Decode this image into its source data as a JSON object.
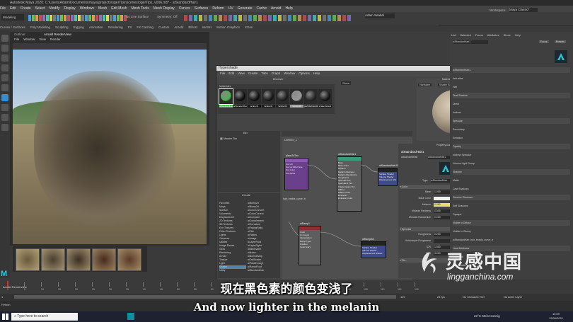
{
  "window": {
    "title": "Autodesk Maya 2020: C:\\Users\\Adam\\Documents\\maya\\projects\\ogerTips\\scenes\\ogerTips_v006.mb* - aiStandardHair1",
    "workspace_label": "Workspace:",
    "workspace_value": "Maya Classic*"
  },
  "menubar": {
    "mode": "Modeling",
    "items": [
      "File",
      "Edit",
      "Create",
      "Select",
      "Modify",
      "Display",
      "Windows",
      "Mesh",
      "Edit Mesh",
      "Mesh Tools",
      "Mesh Display",
      "Curves",
      "Surfaces",
      "Deform",
      "UV",
      "Generate",
      "Cache",
      "Arnold",
      "Help"
    ]
  },
  "shelf": {
    "tabs": [
      "Curves / Surfaces",
      "Poly Modeling",
      "Sculpting",
      "Rigging",
      "Animation",
      "Rendering",
      "FX",
      "FX Caching",
      "Custom",
      "Arnold",
      "Bifrost",
      "MASH",
      "Motion Graphics",
      "XGen"
    ],
    "live_surface": "No Live Surface",
    "symmetry": "Symmetry: Off",
    "sign_in": "Adam Seakal"
  },
  "render_view": {
    "panel_tabs": [
      "Outliner",
      "Arnold RenderView"
    ],
    "menu": [
      "File",
      "Window",
      "View",
      "Render"
    ]
  },
  "hypershade": {
    "title": "Hypershade",
    "menu": [
      "File",
      "Edit",
      "View",
      "Create",
      "Tabs",
      "Graph",
      "Window",
      "Options",
      "Help"
    ],
    "browser_label": "Browser",
    "materials_tab": "Materials",
    "show_label": "Show",
    "materials": [
      {
        "name": "aiStandardHair1",
        "color": "#4caf50",
        "selected": true
      },
      {
        "name": "aiStandardSurf",
        "color": "#111111",
        "selected": false
      },
      {
        "name": "lambert1",
        "color": "#141414",
        "selected": false
      },
      {
        "name": "lambert2",
        "color": "#1b1b1b",
        "selected": false
      },
      {
        "name": "lambert3",
        "color": "#222222",
        "selected": false
      },
      {
        "name": "lambert4",
        "color": "#9a9a9a",
        "selected": false
      },
      {
        "name": "particleCloud1",
        "color": "#2a2a2a",
        "selected": false
      },
      {
        "name": "shaderGlow1",
        "color": "#181818",
        "selected": false
      }
    ],
    "bin_label": "Bin",
    "master_bin": "Master Bin",
    "create_label": "Create",
    "create_tree": [
      "Favorites",
      "Maya",
      "Surface",
      "Volumetric",
      "Displacement",
      "2D Textures",
      "3D Textures",
      "Env Textures",
      "Other Textures",
      "Lights",
      "Cameras",
      "Utilities",
      "Image Planes",
      "Glow",
      "Rendering",
      "Arnold",
      "Texture",
      "Light",
      "Shader",
      "Utility"
    ],
    "create_list": [
      "aiBump2d",
      "aiBump3d",
      "aiColorConvert",
      "aiColorCorrect",
      "aiCompare",
      "aiComplement",
      "aiCurvature",
      "aiFacingRatio",
      "aiFlat",
      "aiFlakes",
      "aiImage",
      "aiLayerFloat",
      "aiLayerRgba",
      "aiMixShader",
      "aiNoise",
      "aiNormalMap",
      "aiOslShader",
      "aiPassthrough",
      "aiRampFloat",
      "aiStandardHair"
    ],
    "graph_tab": "Untitled_1",
    "nodes": {
      "place": {
        "title": "place2dTex",
        "ports": [
          "Out UV",
          "Out Uv Filter Size",
          "Out Color",
          "Out Alpha"
        ]
      },
      "hair": {
        "title": "aiStandardHair1",
        "ports": [
          "Base",
          "Base Color",
          "Melanin",
          "Melanin Redness",
          "Melanin Randomize",
          "Roughness",
          "Specular Tint",
          "Specular 2 Tint",
          "Transmission Tint",
          "Diffuse",
          "Diffuse Color",
          "Emission",
          "Emission Color"
        ]
      },
      "sg1": {
        "title": "aiStandardHair1SG",
        "ports": [
          "Surface Shader",
          "Volume Shader",
          "Displacement Shader"
        ]
      },
      "ramp": {
        "title": "aiRamp1",
        "ports": [
          "Color",
          "Uv Coord",
          "Interpolation",
          "Ramp Type",
          "Position",
          "Color Entry"
        ]
      },
      "sg2": {
        "title": "aiRampSG",
        "ports": [
          "Surface Shader",
          "Volume Shader",
          "Displacement Shader"
        ]
      },
      "hair_label": "hair_braids_curve_tr"
    },
    "material_viewer": {
      "label": "Material Viewer",
      "renderer": "Hardware",
      "geometry": "Shader Ball",
      "env": "Interior Cube"
    },
    "property_editor": {
      "label": "Property Editor",
      "node_name": "aiStandardHair1",
      "type_label": "aiStandardHair",
      "presets": "Presets",
      "type_row_label": "Type",
      "type_row_value": "aiStandardHair",
      "sections": [
        "Color",
        "Specular",
        "Tint"
      ],
      "rows": [
        {
          "label": "Base",
          "value": "1.000",
          "fill": 1.0
        },
        {
          "label": "Base Color",
          "value": "",
          "fill": 1.0
        },
        {
          "label": "Melanin",
          "value": "0.060",
          "fill": 0.06
        },
        {
          "label": "Melanin Redness",
          "value": "0.500",
          "fill": 0.5
        },
        {
          "label": "Melanin Randomize",
          "value": "0.000",
          "fill": 0.0
        },
        {
          "label": "Roughness",
          "value": "0.200",
          "fill": 0.2
        },
        {
          "label": "Anisotropic Roughness",
          "value": "",
          "fill": 0.0
        },
        {
          "label": "IOR",
          "value": "1.550",
          "fill": 0.55
        },
        {
          "label": "Shift",
          "value": "3.000",
          "fill": 0.15
        }
      ]
    }
  },
  "attribute_editor": {
    "tabs": [
      "List",
      "Selected",
      "Focus",
      "Attributes",
      "Show",
      "Help"
    ],
    "node_field": "aiStandardHair1",
    "focus": "Focus",
    "presets": "Presets",
    "show": "Show",
    "hide": "Hide",
    "items": [
      "aiStandardHair1",
      "Anti-alias",
      "Hair",
      "Dual Shadow",
      "Direct",
      "Indirect",
      "Specular",
      "Secondary",
      "Emission",
      "Opacity",
      "Indirect Specular",
      "Volume Light Group",
      "Shadow",
      "Matte",
      "Cast Shadows",
      "Receive Shadows",
      "Self Shadows",
      "Opaque",
      "Visible in Diffuse",
      "Visible in Glossy",
      "aiStandardHair_hair_braids_curve_tr",
      "Load Attributes",
      "Copy Tab",
      "Hair Shader"
    ]
  },
  "time_slider": {
    "ticks": [
      "1",
      "5",
      "10",
      "15",
      "20",
      "25",
      "30",
      "35",
      "40",
      "45",
      "50",
      "55",
      "60",
      "65",
      "70",
      "75",
      "80",
      "85",
      "90",
      "95",
      "100",
      "105",
      "110",
      "115",
      "120"
    ],
    "current_frame": "1",
    "start": "1",
    "end": "120",
    "fps": "24 fps",
    "character_set": "No Character Set",
    "anim_layer": "No Anim Layer"
  },
  "command_line": {
    "language": "Python",
    "status": "Arnold Renderview"
  },
  "taskbar": {
    "search": "Type here to search",
    "weather": "22°C Meist sonnig",
    "time": "15:59",
    "date": "12/06/2021"
  },
  "subtitles": {
    "zh": "现在黑色素的颜色变浅了",
    "en": "And now lighter in the melanin"
  },
  "watermark": {
    "cn": "灵感中国",
    "en": "lingganchina.com"
  }
}
